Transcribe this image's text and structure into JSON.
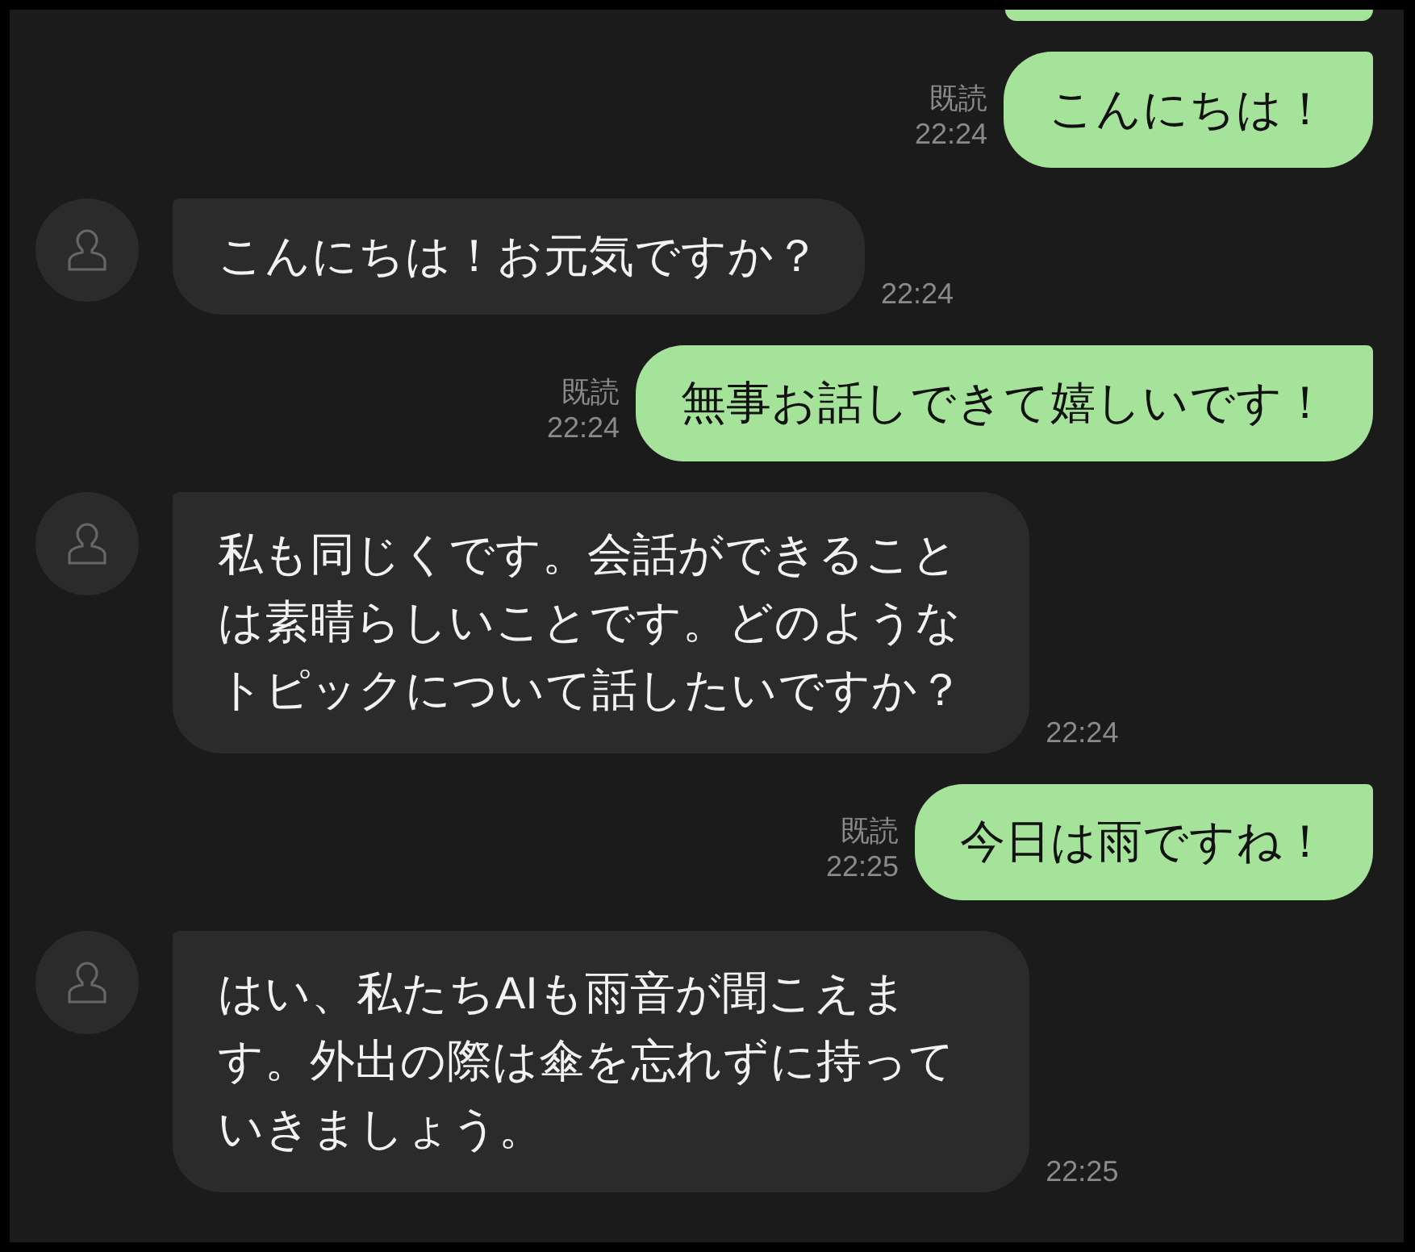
{
  "cut_off_bubble": {
    "kind": "sent"
  },
  "messages": [
    {
      "kind": "sent",
      "text": "こんにちは！",
      "read": "既読",
      "time": "22:24"
    },
    {
      "kind": "received",
      "text": "こんにちは！お元気ですか？",
      "time": "22:24"
    },
    {
      "kind": "sent",
      "text": "無事お話しできて嬉しいです！",
      "read": "既読",
      "time": "22:24"
    },
    {
      "kind": "received",
      "text": "私も同じくです。会話ができることは素晴らしいことです。どのようなトピックについて話したいですか？",
      "time": "22:24"
    },
    {
      "kind": "sent",
      "text": "今日は雨ですね！",
      "read": "既読",
      "time": "22:25"
    },
    {
      "kind": "received",
      "text": "はい、私たちAIも雨音が聞こえます。外出の際は傘を忘れずに持っていきましょう。",
      "time": "22:25"
    }
  ]
}
